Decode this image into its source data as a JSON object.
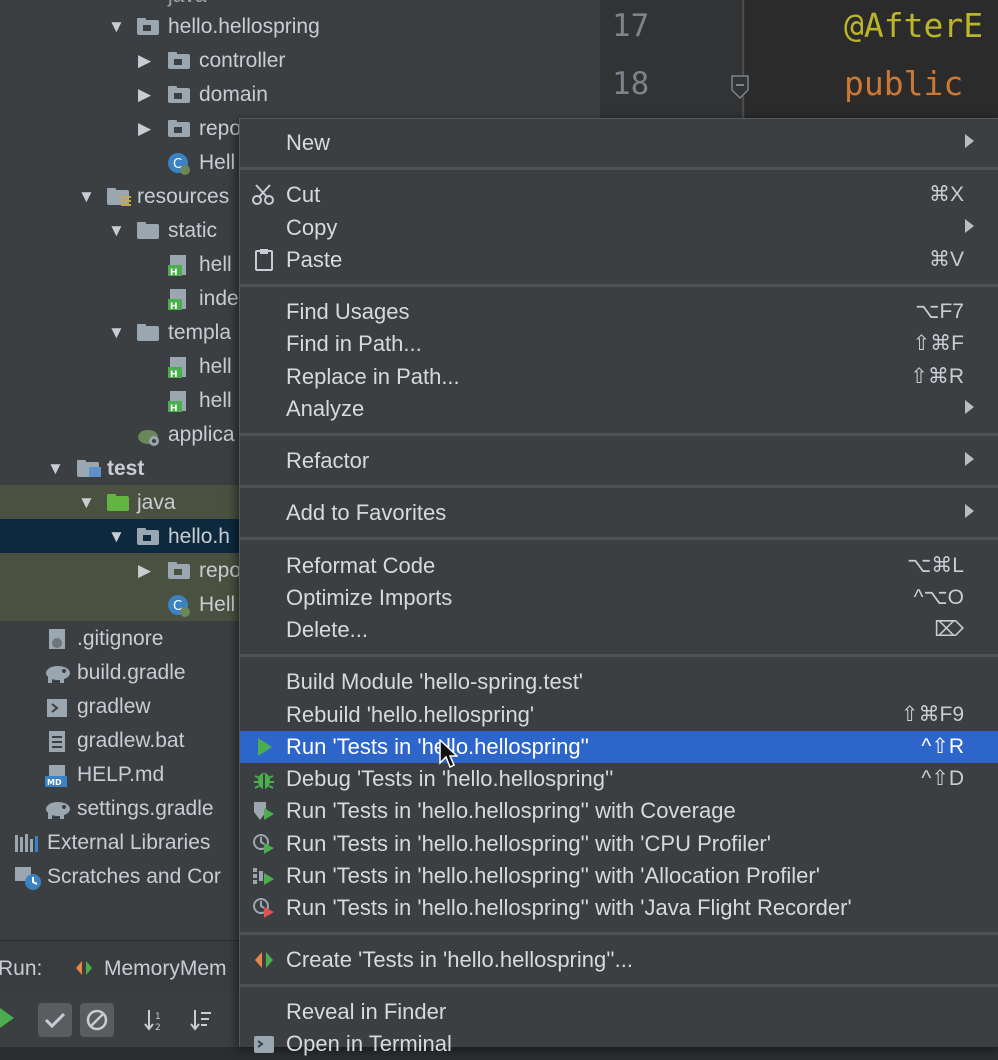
{
  "project_tree": {
    "items": [
      {
        "label": "hello.hellospring",
        "icon": "package-folder-icon",
        "arrow": "▼"
      },
      {
        "label": "controller",
        "icon": "package-folder-icon",
        "arrow": "▶"
      },
      {
        "label": "domain",
        "icon": "package-folder-icon",
        "arrow": "▶"
      },
      {
        "label": "repo",
        "icon": "package-folder-icon",
        "arrow": "▶"
      },
      {
        "label": "Hell",
        "icon": "spring-class-icon",
        "arrow": ""
      },
      {
        "label": "resources",
        "icon": "resources-folder-icon",
        "arrow": "▼"
      },
      {
        "label": "static",
        "icon": "folder-icon",
        "arrow": "▼"
      },
      {
        "label": "hell",
        "icon": "html-file-icon",
        "arrow": ""
      },
      {
        "label": "inde",
        "icon": "html-file-icon",
        "arrow": ""
      },
      {
        "label": "templa",
        "icon": "folder-icon",
        "arrow": "▼"
      },
      {
        "label": "hell",
        "icon": "html-file-icon",
        "arrow": ""
      },
      {
        "label": "hell",
        "icon": "html-file-icon",
        "arrow": ""
      },
      {
        "label": "applica",
        "icon": "properties-file-icon",
        "arrow": ""
      },
      {
        "label": "test",
        "icon": "module-folder-icon",
        "arrow": "▼"
      },
      {
        "label": "java",
        "icon": "test-source-folder-icon",
        "arrow": "▼"
      },
      {
        "label": "hello.h",
        "icon": "package-folder-icon",
        "arrow": "▼"
      },
      {
        "label": "repo",
        "icon": "package-folder-icon",
        "arrow": "▶"
      },
      {
        "label": "Hell",
        "icon": "spring-class-icon",
        "arrow": ""
      },
      {
        "label": ".gitignore",
        "icon": "gitignore-file-icon",
        "arrow": ""
      },
      {
        "label": "build.gradle",
        "icon": "gradle-icon",
        "arrow": ""
      },
      {
        "label": "gradlew",
        "icon": "terminal-file-icon",
        "arrow": ""
      },
      {
        "label": "gradlew.bat",
        "icon": "text-file-icon",
        "arrow": ""
      },
      {
        "label": "HELP.md",
        "icon": "markdown-file-icon",
        "arrow": ""
      },
      {
        "label": "settings.gradle",
        "icon": "gradle-icon",
        "arrow": ""
      },
      {
        "label": "External Libraries",
        "icon": "libraries-icon",
        "arrow": ""
      },
      {
        "label": "Scratches and Cor",
        "icon": "scratches-icon",
        "arrow": ""
      }
    ]
  },
  "editor": {
    "lines": [
      {
        "number": "17",
        "code": "@AfterE",
        "color": "#bbb529"
      },
      {
        "number": "18",
        "code": "public",
        "color": "#cc7832"
      }
    ]
  },
  "run_panel": {
    "label": "Run:",
    "tab": "MemoryMem"
  },
  "context_menu": {
    "items": [
      {
        "label": "New",
        "shortcut": "",
        "submenu": true,
        "icon": ""
      },
      {
        "label": "Cut",
        "shortcut": "⌘X",
        "submenu": false,
        "icon": "scissors-icon"
      },
      {
        "label": "Copy",
        "shortcut": "",
        "submenu": true,
        "icon": ""
      },
      {
        "label": "Paste",
        "shortcut": "⌘V",
        "submenu": false,
        "icon": "clipboard-icon"
      },
      {
        "label": "Find Usages",
        "shortcut": "⌥F7",
        "submenu": false,
        "icon": ""
      },
      {
        "label": "Find in Path...",
        "shortcut": "⇧⌘F",
        "submenu": false,
        "icon": ""
      },
      {
        "label": "Replace in Path...",
        "shortcut": "⇧⌘R",
        "submenu": false,
        "icon": ""
      },
      {
        "label": "Analyze",
        "shortcut": "",
        "submenu": true,
        "icon": ""
      },
      {
        "label": "Refactor",
        "shortcut": "",
        "submenu": true,
        "icon": ""
      },
      {
        "label": "Add to Favorites",
        "shortcut": "",
        "submenu": true,
        "icon": ""
      },
      {
        "label": "Reformat Code",
        "shortcut": "⌥⌘L",
        "submenu": false,
        "icon": ""
      },
      {
        "label": "Optimize Imports",
        "shortcut": "^⌥O",
        "submenu": false,
        "icon": ""
      },
      {
        "label": "Delete...",
        "shortcut": "⌦",
        "submenu": false,
        "icon": ""
      },
      {
        "label": "Build Module 'hello-spring.test'",
        "shortcut": "",
        "submenu": false,
        "icon": ""
      },
      {
        "label": "Rebuild 'hello.hellospring'",
        "shortcut": "⇧⌘F9",
        "submenu": false,
        "icon": ""
      },
      {
        "label": "Run 'Tests in 'hello.hellospring''",
        "shortcut": "^⇧R",
        "submenu": false,
        "icon": "run-icon",
        "active": true
      },
      {
        "label": "Debug 'Tests in 'hello.hellospring''",
        "shortcut": "^⇧D",
        "submenu": false,
        "icon": "debug-icon"
      },
      {
        "label": "Run 'Tests in 'hello.hellospring'' with Coverage",
        "shortcut": "",
        "submenu": false,
        "icon": "coverage-icon"
      },
      {
        "label": "Run 'Tests in 'hello.hellospring'' with 'CPU Profiler'",
        "shortcut": "",
        "submenu": false,
        "icon": "cpu-profiler-icon"
      },
      {
        "label": "Run 'Tests in 'hello.hellospring'' with 'Allocation Profiler'",
        "shortcut": "",
        "submenu": false,
        "icon": "allocation-profiler-icon"
      },
      {
        "label": "Run 'Tests in 'hello.hellospring'' with 'Java Flight Recorder'",
        "shortcut": "",
        "submenu": false,
        "icon": "flight-recorder-icon"
      },
      {
        "label": "Create 'Tests in 'hello.hellospring''...",
        "shortcut": "",
        "submenu": false,
        "icon": "create-config-icon"
      },
      {
        "label": "Reveal in Finder",
        "shortcut": "",
        "submenu": false,
        "icon": ""
      },
      {
        "label": "Open in Terminal",
        "shortcut": "",
        "submenu": false,
        "icon": "terminal-icon"
      }
    ]
  },
  "colors": {
    "selection": "#2e65ca",
    "tree_selection": "#0d293e",
    "test_highlight": "#4a5140",
    "run_green": "#4aae4f"
  }
}
